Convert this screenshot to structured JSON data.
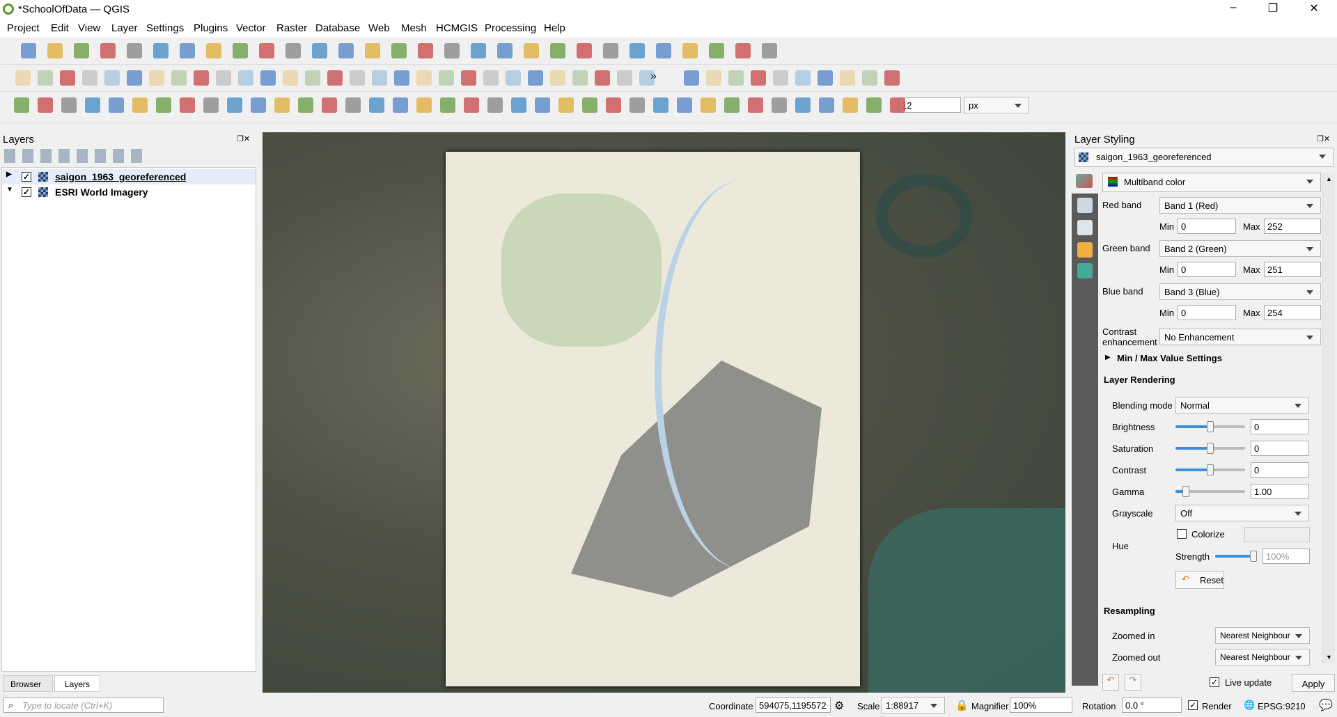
{
  "window": {
    "title": "*SchoolOfData — QGIS",
    "minimize": "–",
    "maximize": "❐",
    "close": "✕"
  },
  "menu": [
    "Project",
    "Edit",
    "View",
    "Layer",
    "Settings",
    "Plugins",
    "Vector",
    "Raster",
    "Database",
    "Web",
    "Mesh",
    "HCMGIS",
    "Processing",
    "Help"
  ],
  "toolbar": {
    "font_size": "12",
    "unit": "px",
    "more": "»"
  },
  "layers_panel": {
    "title": "Layers",
    "layers": [
      {
        "name": "saigon_1963_georeferenced",
        "checked": true
      },
      {
        "name": "ESRI World Imagery",
        "checked": true
      }
    ],
    "tabs": [
      "Browser",
      "Layers"
    ]
  },
  "locator": {
    "placeholder": "Type to locate (Ctrl+K)"
  },
  "styling": {
    "title": "Layer Styling",
    "layer": "saigon_1963_georeferenced",
    "renderer": "Multiband color",
    "red": {
      "label": "Red band",
      "band": "Band 1 (Red)",
      "min": "0",
      "max": "252"
    },
    "green": {
      "label": "Green band",
      "band": "Band 2 (Green)",
      "min": "0",
      "max": "251"
    },
    "blue": {
      "label": "Blue band",
      "band": "Band 3 (Blue)",
      "min": "0",
      "max": "254"
    },
    "min_label": "Min",
    "max_label": "Max",
    "contrast_label": "Contrast enhancement",
    "contrast": "No Enhancement",
    "minmax": "Min / Max Value Settings",
    "rendering": {
      "title": "Layer Rendering",
      "blending_label": "Blending mode",
      "blending": "Normal",
      "brightness_label": "Brightness",
      "brightness": "0",
      "saturation_label": "Saturation",
      "saturation": "0",
      "contrast_label": "Contrast",
      "contrast": "0",
      "gamma_label": "Gamma",
      "gamma": "1.00",
      "grayscale_label": "Grayscale",
      "grayscale": "Off",
      "hue_label": "Hue",
      "colorize_label": "Colorize",
      "colorize": false,
      "strength_label": "Strength",
      "strength": "100%",
      "reset": "Reset"
    },
    "resampling": {
      "title": "Resampling",
      "zoomed_in_label": "Zoomed in",
      "zoomed_in": "Nearest Neighbour",
      "zoomed_out_label": "Zoomed out",
      "zoomed_out": "Nearest Neighbour"
    },
    "live_update": "Live update",
    "apply": "Apply"
  },
  "status": {
    "coordinate_label": "Coordinate",
    "coordinate": "594075,1195572",
    "scale_label": "Scale",
    "scale": "1:88917",
    "magnifier_label": "Magnifier",
    "magnifier": "100%",
    "rotation_label": "Rotation",
    "rotation": "0.0 °",
    "render_label": "Render",
    "crs": "EPSG:9210"
  }
}
